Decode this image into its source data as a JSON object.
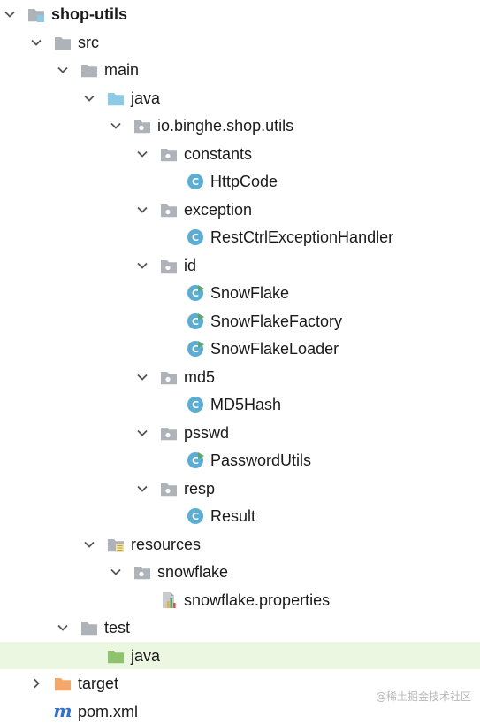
{
  "project_tree": {
    "nodes": [
      {
        "name": "tree-node-shop-utils",
        "label": "shop-utils",
        "icon": "module-folder-icon",
        "depth": 0,
        "expanded": true,
        "bold": true
      },
      {
        "name": "tree-node-src",
        "label": "src",
        "icon": "folder-icon",
        "depth": 1,
        "expanded": true
      },
      {
        "name": "tree-node-main",
        "label": "main",
        "icon": "folder-icon",
        "depth": 2,
        "expanded": true
      },
      {
        "name": "tree-node-java",
        "label": "java",
        "icon": "source-root-folder-icon",
        "depth": 3,
        "expanded": true
      },
      {
        "name": "tree-node-io-binghe-shop-utils",
        "label": "io.binghe.shop.utils",
        "icon": "package-icon",
        "depth": 4,
        "expanded": true
      },
      {
        "name": "tree-node-constants",
        "label": "constants",
        "icon": "package-icon",
        "depth": 5,
        "expanded": true
      },
      {
        "name": "tree-node-httpcode",
        "label": "HttpCode",
        "icon": "class-icon",
        "depth": 6
      },
      {
        "name": "tree-node-exception",
        "label": "exception",
        "icon": "package-icon",
        "depth": 5,
        "expanded": true
      },
      {
        "name": "tree-node-restctrlexceptionhandler",
        "label": "RestCtrlExceptionHandler",
        "icon": "class-icon",
        "depth": 6
      },
      {
        "name": "tree-node-id",
        "label": "id",
        "icon": "package-icon",
        "depth": 5,
        "expanded": true
      },
      {
        "name": "tree-node-snowflake",
        "label": "SnowFlake",
        "icon": "class-run-icon",
        "depth": 6
      },
      {
        "name": "tree-node-snowflakefactory",
        "label": "SnowFlakeFactory",
        "icon": "class-run-icon",
        "depth": 6
      },
      {
        "name": "tree-node-snowflakeloader",
        "label": "SnowFlakeLoader",
        "icon": "class-run-icon",
        "depth": 6
      },
      {
        "name": "tree-node-md5",
        "label": "md5",
        "icon": "package-icon",
        "depth": 5,
        "expanded": true
      },
      {
        "name": "tree-node-md5hash",
        "label": "MD5Hash",
        "icon": "class-icon",
        "depth": 6
      },
      {
        "name": "tree-node-psswd",
        "label": "psswd",
        "icon": "package-icon",
        "depth": 5,
        "expanded": true
      },
      {
        "name": "tree-node-passwordutils",
        "label": "PasswordUtils",
        "icon": "class-run-icon",
        "depth": 6
      },
      {
        "name": "tree-node-resp",
        "label": "resp",
        "icon": "package-icon",
        "depth": 5,
        "expanded": true
      },
      {
        "name": "tree-node-result",
        "label": "Result",
        "icon": "class-icon",
        "depth": 6
      },
      {
        "name": "tree-node-resources",
        "label": "resources",
        "icon": "resources-folder-icon",
        "depth": 3,
        "expanded": true
      },
      {
        "name": "tree-node-snowflake-folder",
        "label": "snowflake",
        "icon": "package-icon",
        "depth": 4,
        "expanded": true
      },
      {
        "name": "tree-node-snowflake-properties",
        "label": "snowflake.properties",
        "icon": "properties-file-icon",
        "depth": 5
      },
      {
        "name": "tree-node-test",
        "label": "test",
        "icon": "folder-icon",
        "depth": 2,
        "expanded": true
      },
      {
        "name": "tree-node-test-java",
        "label": "java",
        "icon": "test-root-folder-icon",
        "depth": 3,
        "highlighted": true
      },
      {
        "name": "tree-node-target",
        "label": "target",
        "icon": "excluded-folder-icon",
        "depth": 1,
        "expanded": false
      },
      {
        "name": "tree-node-pom-xml",
        "label": "pom.xml",
        "icon": "maven-icon",
        "depth": 1
      }
    ]
  },
  "watermark": "@稀土掘金技术社区",
  "colors": {
    "folder": "#aeb3b9",
    "source_root": "#8ec9e6",
    "test_root": "#8ec26c",
    "excluded": "#f4a76a",
    "class_badge": "#5aaed6",
    "run_marker": "#59a869",
    "maven": "#2e6fd6",
    "highlight_row": "#ecf7e1"
  }
}
